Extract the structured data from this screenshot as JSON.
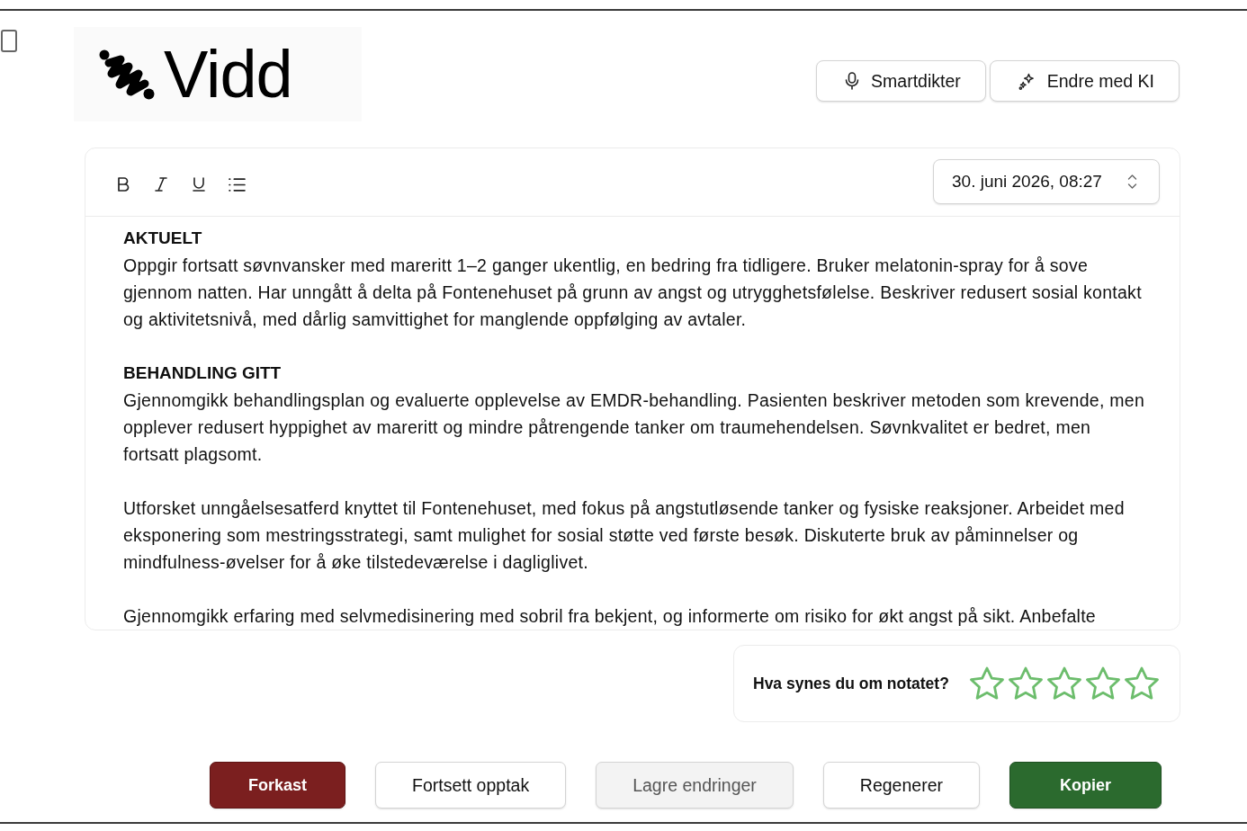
{
  "logo": {
    "text": "Vidd"
  },
  "header_actions": [
    {
      "label": "Smartdikter"
    },
    {
      "label": "Endre med KI"
    }
  ],
  "editor": {
    "date_picker": {
      "value": "30. juni 2026, 08:27"
    },
    "sections": [
      {
        "heading": "AKTUELT",
        "paragraphs": [
          "Oppgir fortsatt søvnvansker med mareritt 1–2 ganger ukentlig, en bedring fra tidligere. Bruker melatonin-spray for å sove gjennom natten. Har unngått å delta på Fontenehuset på grunn av angst og utrygghetsfølelse. Beskriver redusert sosial kontakt og aktivitetsnivå, med dårlig samvittighet for manglende oppfølging av avtaler."
        ]
      },
      {
        "heading": "BEHANDLING GITT",
        "paragraphs": [
          "Gjennomgikk behandlingsplan og evaluerte opplevelse av EMDR-behandling. Pasienten beskriver metoden som krevende, men opplever redusert hyppighet av mareritt og mindre påtrengende tanker om traumehendelsen. Søvnkvalitet er bedret, men fortsatt plagsomt.",
          "Utforsket unngåelsesatferd knyttet til Fontenehuset, med fokus på angstutløsende tanker og fysiske reaksjoner. Arbeidet med eksponering som mestringsstrategi, samt mulighet for sosial støtte ved første besøk. Diskuterte bruk av påminnelser og mindfulness-øvelser for å øke tilstedeværelse i dagliglivet.",
          "Gjennomgikk erfaring med selvmedisinering med sobril fra bekjent, og informerte om risiko for økt angst på sikt. Anbefalte"
        ]
      }
    ]
  },
  "rating": {
    "question": "Hva synes du om notatet?",
    "stars": 0
  },
  "actions": [
    {
      "label": "Forkast",
      "kind": "danger",
      "disabled": false
    },
    {
      "label": "Fortsett opptak",
      "kind": "secondary",
      "disabled": false
    },
    {
      "label": "Lagre endringer",
      "kind": "secondary",
      "disabled": true
    },
    {
      "label": "Regenerer",
      "kind": "secondary",
      "disabled": false
    },
    {
      "label": "Kopier",
      "kind": "primary",
      "disabled": false
    }
  ]
}
